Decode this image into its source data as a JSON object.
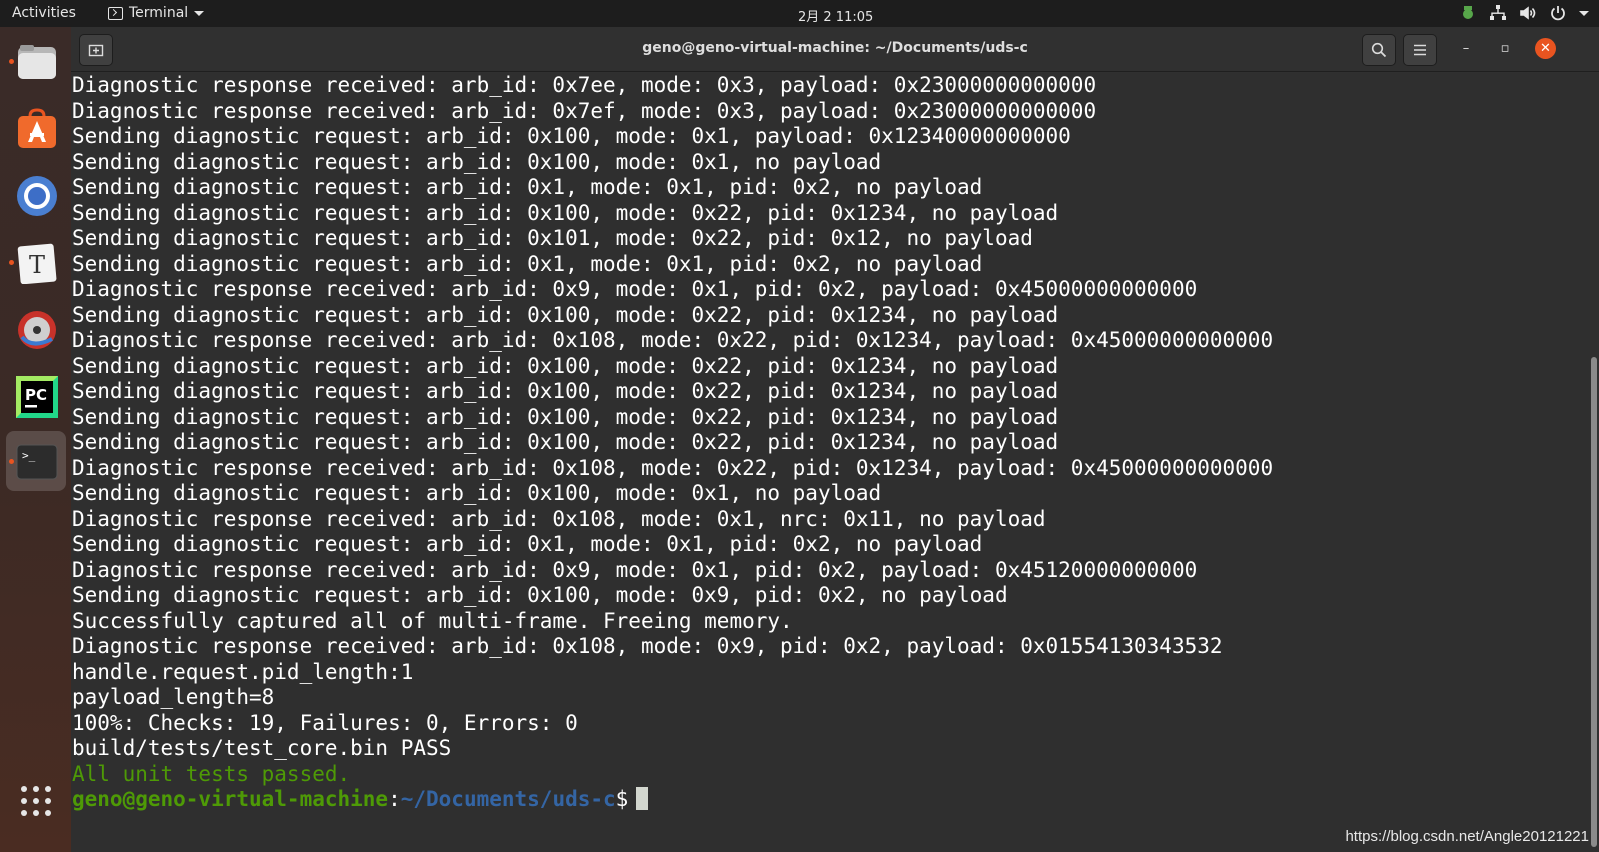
{
  "topbar": {
    "activities": "Activities",
    "app_name": "Terminal",
    "clock": "2月 2  11:05"
  },
  "dock": {
    "items": [
      {
        "name": "files",
        "running": true
      },
      {
        "name": "software",
        "running": false
      },
      {
        "name": "chromium",
        "running": false
      },
      {
        "name": "typora",
        "running": true
      },
      {
        "name": "media",
        "running": false
      },
      {
        "name": "pycharm",
        "running": false
      },
      {
        "name": "terminal",
        "running": true,
        "active": true
      }
    ],
    "apps_grid": "show-applications"
  },
  "window": {
    "title": "geno@geno-virtual-machine: ~/Documents/uds-c",
    "minimize": "–",
    "maximize": "▫",
    "close": "✕"
  },
  "terminal": {
    "lines": [
      "Diagnostic response received: arb_id: 0x7ee, mode: 0x3, payload: 0x23000000000000",
      "Diagnostic response received: arb_id: 0x7ef, mode: 0x3, payload: 0x23000000000000",
      "Sending diagnostic request: arb_id: 0x100, mode: 0x1, payload: 0x12340000000000",
      "Sending diagnostic request: arb_id: 0x100, mode: 0x1, no payload",
      "Sending diagnostic request: arb_id: 0x1, mode: 0x1, pid: 0x2, no payload",
      "Sending diagnostic request: arb_id: 0x100, mode: 0x22, pid: 0x1234, no payload",
      "Sending diagnostic request: arb_id: 0x101, mode: 0x22, pid: 0x12, no payload",
      "Sending diagnostic request: arb_id: 0x1, mode: 0x1, pid: 0x2, no payload",
      "Diagnostic response received: arb_id: 0x9, mode: 0x1, pid: 0x2, payload: 0x45000000000000",
      "Sending diagnostic request: arb_id: 0x100, mode: 0x22, pid: 0x1234, no payload",
      "Diagnostic response received: arb_id: 0x108, mode: 0x22, pid: 0x1234, payload: 0x45000000000000",
      "Sending diagnostic request: arb_id: 0x100, mode: 0x22, pid: 0x1234, no payload",
      "Sending diagnostic request: arb_id: 0x100, mode: 0x22, pid: 0x1234, no payload",
      "Sending diagnostic request: arb_id: 0x100, mode: 0x22, pid: 0x1234, no payload",
      "Sending diagnostic request: arb_id: 0x100, mode: 0x22, pid: 0x1234, no payload",
      "Diagnostic response received: arb_id: 0x108, mode: 0x22, pid: 0x1234, payload: 0x45000000000000",
      "Sending diagnostic request: arb_id: 0x100, mode: 0x1, no payload",
      "Diagnostic response received: arb_id: 0x108, mode: 0x1, nrc: 0x11, no payload",
      "Sending diagnostic request: arb_id: 0x1, mode: 0x1, pid: 0x2, no payload",
      "Diagnostic response received: arb_id: 0x9, mode: 0x1, pid: 0x2, payload: 0x45120000000000",
      "Sending diagnostic request: arb_id: 0x100, mode: 0x9, pid: 0x2, no payload",
      "Successfully captured all of multi-frame. Freeing memory.",
      "Diagnostic response received: arb_id: 0x108, mode: 0x9, pid: 0x2, payload: 0x01554130343532",
      "handle.request.pid_length:1",
      "payload_length=8",
      "100%: Checks: 19, Failures: 0, Errors: 0",
      "build/tests/test_core.bin PASS"
    ],
    "success_line": "All unit tests passed.",
    "prompt_user": "geno@geno-virtual-machine",
    "prompt_sep": ":",
    "prompt_path": "~/Documents/uds-c",
    "prompt_symbol": "$"
  },
  "watermark": "https://blog.csdn.net/Angle20121221",
  "colors": {
    "accent": "#e95420",
    "success": "#4e9a06",
    "path": "#3465a4"
  }
}
